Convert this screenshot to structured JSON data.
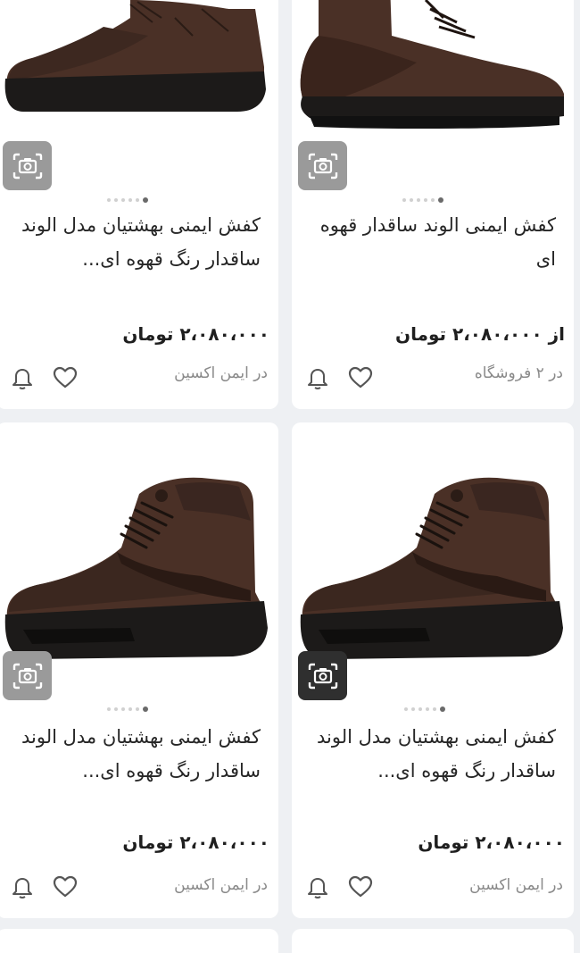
{
  "products": [
    {
      "title": "کفش ایمنی الوند ساقدار قهوه ای",
      "price": "از ۲،۰۸۰،۰۰۰ تومان",
      "seller": "در ۲ فروشگاه",
      "image_desc": "brown leather safety boot"
    },
    {
      "title": "کفش ایمنی بهشتیان مدل الوند ساقدار رنگ قهوه ای...",
      "price": "۲،۰۸۰،۰۰۰ تومان",
      "seller": "در ایمن اکسین",
      "image_desc": "brown leather safety boot"
    },
    {
      "title": "کفش ایمنی بهشتیان مدل الوند ساقدار رنگ قهوه ای...",
      "price": "۲،۰۸۰،۰۰۰ تومان",
      "seller": "در ایمن اکسین",
      "image_desc": "brown leather safety boot"
    },
    {
      "title": "کفش ایمنی بهشتیان مدل الوند ساقدار رنگ قهوه ای...",
      "price": "۲،۰۸۰،۰۰۰ تومان",
      "seller": "در ایمن اکسین",
      "image_desc": "brown leather safety boot"
    }
  ],
  "icons": {
    "image_search": "camera-search-icon",
    "favorite": "heart-icon",
    "notify": "bell-icon"
  },
  "colors": {
    "background": "#eef0f3",
    "card": "#ffffff",
    "boot_leather": "#4a3026",
    "boot_sole": "#1c1a19"
  }
}
